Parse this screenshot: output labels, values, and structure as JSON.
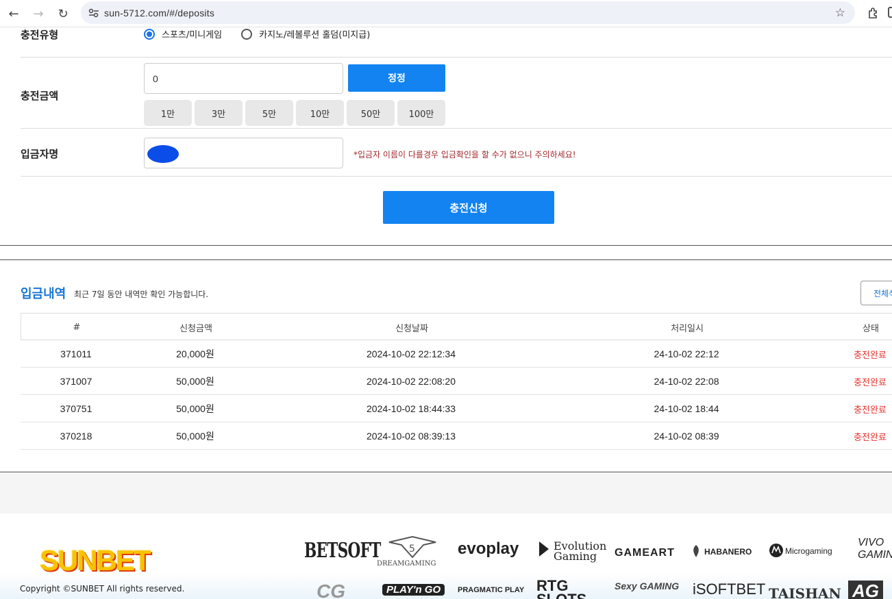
{
  "browser": {
    "url": "sun-5712.com/#/deposits"
  },
  "form": {
    "type_label": "충전유형",
    "type_options": [
      "스포츠/미니게임",
      "카지노/레볼루션 홀덤(미지급)"
    ],
    "amount_label": "충전금액",
    "amount_value": "0",
    "reset_label": "정정",
    "chips": [
      "1만",
      "3만",
      "5만",
      "10만",
      "50만",
      "100만"
    ],
    "name_label": "입금자명",
    "name_warning": "*입금자 이름이 다를경우 입금확인을 할 수가 없으니 주의하세요!",
    "submit_label": "충전신청"
  },
  "history": {
    "title": "입금내역",
    "subtitle": "최근 7일 동안 내역만 확인 가능합니다.",
    "all_button": "전체삭",
    "columns": [
      "#",
      "신청금액",
      "신청날짜",
      "처리일시",
      "상태"
    ],
    "rows": [
      [
        "371011",
        "20,000원",
        "2024-10-02 22:12:34",
        "24-10-02 22:12",
        "충전완료"
      ],
      [
        "371007",
        "50,000원",
        "2024-10-02 22:08:20",
        "24-10-02 22:08",
        "충전완료"
      ],
      [
        "370751",
        "50,000원",
        "2024-10-02 18:44:33",
        "24-10-02 18:44",
        "충전완료"
      ],
      [
        "370218",
        "50,000원",
        "2024-10-02 08:39:13",
        "24-10-02 08:39",
        "충전완료"
      ]
    ]
  },
  "footer": {
    "logo": "SUNBET",
    "copyright": "Copyright ©SUNBET All rights reserved.",
    "providers_row1": [
      "BETSOFT",
      "DREAMGAMING",
      "evoplay",
      "Evolution Gaming",
      "GAMEART",
      "HABANERO",
      "Microgaming",
      "VIVO GAMING"
    ],
    "providers_row2": [
      "CG",
      "PLAY'n GO",
      "PRAGMATIC PLAY",
      "RTG SLOTS",
      "Sexy GAMING",
      "iSOFTBET",
      "TAISHAN",
      "AG"
    ]
  },
  "colors": {
    "primary": "#1283f1",
    "title_blue": "#1976d2",
    "status_red": "#e8332f",
    "warning_red": "#a2282c"
  }
}
